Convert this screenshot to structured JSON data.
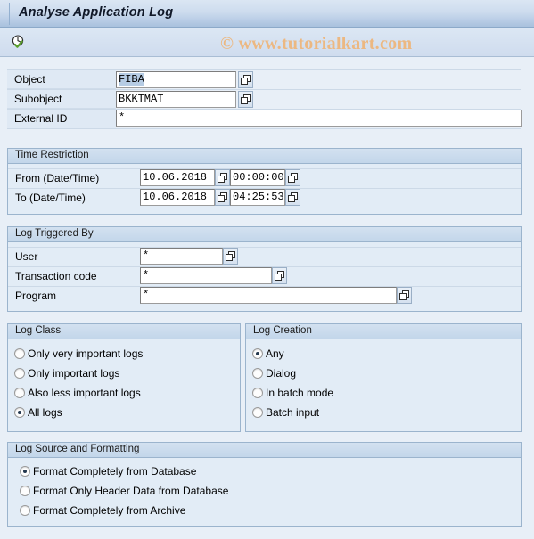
{
  "window": {
    "title": "Analyse Application Log"
  },
  "toolbar": {
    "execute_icon": "clock-check-execute-icon",
    "execute_tooltip": "Execute"
  },
  "watermark": {
    "text": "© www.tutorialkart.com",
    "color": "#ecb882"
  },
  "selection_fields": [
    {
      "label": "Object",
      "value": "FIBA",
      "has_search_help": true,
      "selected": true
    },
    {
      "label": "Subobject",
      "value": "BKKTMAT",
      "has_search_help": true,
      "selected": false
    },
    {
      "label": "External ID",
      "value": "*",
      "has_search_help": false,
      "selected": false
    }
  ],
  "time_restriction": {
    "title": "Time Restriction",
    "rows": [
      {
        "label": "From (Date/Time)",
        "date": "10.06.2018",
        "time": "00:00:00"
      },
      {
        "label": "To (Date/Time)",
        "date": "10.06.2018",
        "time": "04:25:53"
      }
    ]
  },
  "log_triggered_by": {
    "title": "Log Triggered By",
    "rows": [
      {
        "label": "User",
        "value": "*"
      },
      {
        "label": "Transaction code",
        "value": "*"
      },
      {
        "label": "Program",
        "value": "*"
      }
    ]
  },
  "log_class": {
    "title": "Log Class",
    "options": [
      {
        "label": "Only very important logs",
        "selected": false
      },
      {
        "label": "Only important logs",
        "selected": false
      },
      {
        "label": "Also less important logs",
        "selected": false
      },
      {
        "label": "All logs",
        "selected": true
      }
    ]
  },
  "log_creation": {
    "title": "Log Creation",
    "options": [
      {
        "label": "Any",
        "selected": true
      },
      {
        "label": "Dialog",
        "selected": false
      },
      {
        "label": "In batch mode",
        "selected": false
      },
      {
        "label": "Batch input",
        "selected": false
      }
    ]
  },
  "log_source_formatting": {
    "title": "Log Source and Formatting",
    "options": [
      {
        "label": "Format Completely from Database",
        "selected": true
      },
      {
        "label": "Format Only Header Data from Database",
        "selected": false
      },
      {
        "label": "Format Completely from Archive",
        "selected": false
      }
    ]
  },
  "icons": {
    "search_help": "search-help-icon"
  }
}
